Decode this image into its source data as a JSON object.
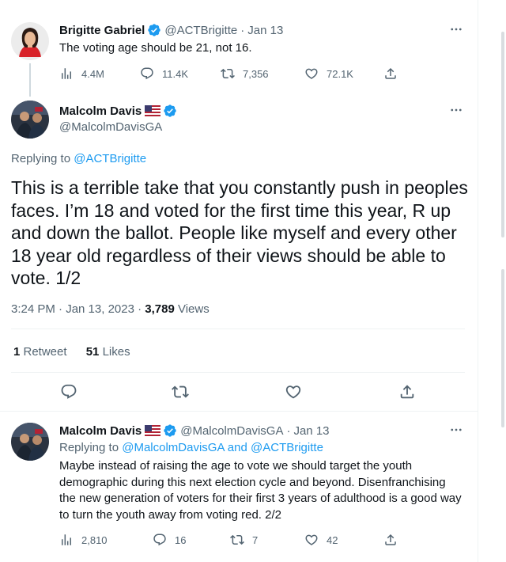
{
  "tweet1": {
    "name": "Brigitte Gabriel",
    "handle": "@ACTBrigitte",
    "time": "Jan 13",
    "text": "The voting age should be 21, not 16.",
    "views": "4.4M",
    "replies": "11.4K",
    "retweets": "7,356",
    "likes": "72.1K"
  },
  "main": {
    "name": "Malcolm Davis",
    "handle": "@MalcolmDavisGA",
    "replying_prefix": "Replying to ",
    "replying_handle": "@ACTBrigitte",
    "text": "This is a terrible take that you constantly push in peoples faces. I’m 18 and voted for the first time this year, R up and down the ballot. People like myself and every other 18 year old regardless of their views should be able to vote. 1/2",
    "timestamp": "3:24 PM · Jan 13, 2023 · ",
    "views_count": "3,789",
    "views_label": " Views",
    "retweet_count": "1",
    "retweet_label": " Retweet",
    "likes_count": "51",
    "likes_label": " Likes"
  },
  "tweet3": {
    "name": "Malcolm Davis",
    "handle": "@MalcolmDavisGA",
    "time": "Jan 13",
    "replying_prefix": "Replying to ",
    "replying_handles": "@MalcolmDavisGA and @ACTBrigitte",
    "text": "Maybe instead of raising the age to vote we should target the youth demographic during this next election cycle and beyond. Disenfranchising the new generation of voters for their first 3 years of adulthood is a good way to turn the youth away from voting red. 2/2",
    "views": "2,810",
    "replies": "16",
    "retweets": "7",
    "likes": "42"
  },
  "icons": [
    "views-icon",
    "reply-icon",
    "retweet-icon",
    "like-icon",
    "share-icon",
    "verified-badge-icon",
    "us-flag-icon",
    "more-icon"
  ],
  "colors": {
    "link": "#1d9bf0",
    "verified": "#1d9bf0",
    "secondary": "#536471",
    "text": "#0f1419"
  }
}
